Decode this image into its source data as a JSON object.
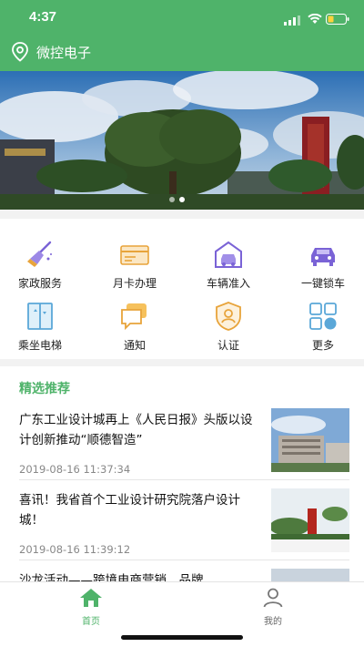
{
  "status": {
    "time": "4:37"
  },
  "header": {
    "location": "微控电子",
    "location_icon": "map-pin-icon"
  },
  "banner": {
    "slide_count": 2,
    "active_slide": 1
  },
  "colors": {
    "brand": "#4fb36a",
    "accent_purple": "#7a63d6",
    "accent_orange": "#e8a43b",
    "accent_blue": "#5aa7d8"
  },
  "services": [
    {
      "label": "家政服务",
      "icon": "broom-icon"
    },
    {
      "label": "月卡办理",
      "icon": "card-icon"
    },
    {
      "label": "车辆准入",
      "icon": "garage-car-icon"
    },
    {
      "label": "一键锁车",
      "icon": "car-lock-icon"
    },
    {
      "label": "乘坐电梯",
      "icon": "elevator-icon"
    },
    {
      "label": "通知",
      "icon": "message-icon"
    },
    {
      "label": "认证",
      "icon": "shield-user-icon"
    },
    {
      "label": "更多",
      "icon": "grid-more-icon"
    }
  ],
  "recommend": {
    "title": "精选推荐",
    "items": [
      {
        "title": "广东工业设计城再上《人民日报》头版以设计创新推动“顺德智造”",
        "date": "2019-08-16 11:37:34"
      },
      {
        "title": "喜讯！我省首个工业设计研究院落户设计城！",
        "date": "2019-08-16 11:39:12"
      },
      {
        "title": "沙龙活动——跨境电商营销、品牌",
        "date": ""
      }
    ]
  },
  "tabbar": [
    {
      "label": "首页",
      "icon": "home-icon",
      "active": true
    },
    {
      "label": "我的",
      "icon": "user-icon",
      "active": false
    }
  ]
}
